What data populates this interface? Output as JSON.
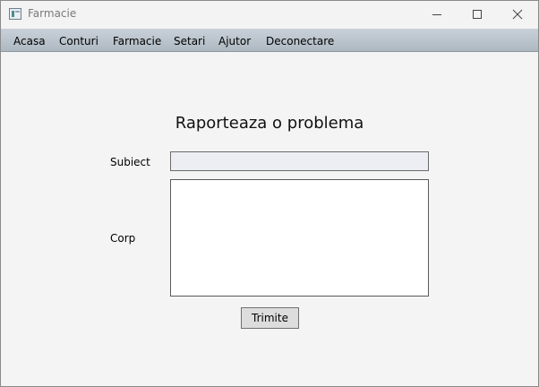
{
  "window": {
    "title": "Farmacie",
    "icon": "app-window-icon"
  },
  "menu": {
    "items": [
      {
        "label": "Acasa"
      },
      {
        "label": "Conturi"
      },
      {
        "label": "Farmacie"
      },
      {
        "label": "Setari"
      },
      {
        "label": "Ajutor"
      },
      {
        "label": "Deconectare"
      }
    ]
  },
  "form": {
    "heading": "Raporteaza o problema",
    "subject_label": "Subiect",
    "subject_value": "",
    "body_label": "Corp",
    "body_value": "",
    "submit_label": "Trimite"
  },
  "colors": {
    "menubar": "#b8c2cb",
    "background": "#f4f4f4"
  }
}
